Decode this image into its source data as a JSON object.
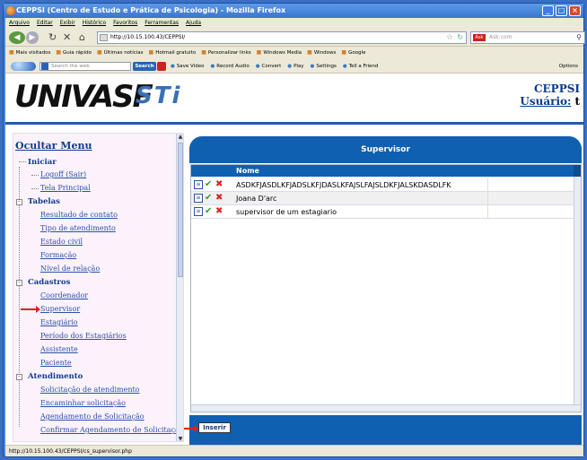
{
  "window": {
    "title": "CEPPSI (Centro de Estudo e Prática de Psicologia) - Mozilla Firefox"
  },
  "menu": [
    "Arquivo",
    "Editar",
    "Exibir",
    "Histórico",
    "Favoritos",
    "Ferramentas",
    "Ajuda"
  ],
  "nav": {
    "url": "http://10.15.100.43/CEPPSI/",
    "search_placeholder": "Ask.com"
  },
  "bookmarks": [
    "Mais visitados",
    "Guia rápido",
    "Últimas notícias",
    "Hotmail gratuito",
    "Personalizar links",
    "Windows Media",
    "Windows",
    "Google"
  ],
  "toolbar2": {
    "search_placeholder": "Search the web",
    "search_btn": "Search",
    "items": [
      "Save Video",
      "Record Audio",
      "Convert",
      "Play",
      "Settings",
      "Tell a Friend"
    ],
    "options": "Options"
  },
  "header": {
    "logo1": "UNIVASF",
    "logo2": "STi",
    "org": "CEPPSI",
    "user_label": "Usuário:",
    "user_value": "t"
  },
  "sidebar": {
    "title": "Ocultar Menu",
    "groups": [
      {
        "label": "Iniciar",
        "items": [
          "Logoff (Sair)",
          "Tela Principal"
        ]
      },
      {
        "label": "Tabelas",
        "items": [
          "Resultado de contato",
          "Tipo de atendimento",
          "Estado civil",
          "Formação",
          "Nível de relação"
        ]
      },
      {
        "label": "Cadastros",
        "items": [
          "Coordenador",
          "Supervisor",
          "Estagiário",
          "Período dos Estagiários",
          "Assistente",
          "Paciente"
        ]
      },
      {
        "label": "Atendimento",
        "items": [
          "Solicitação de atendimento",
          "Encaminhar solicitação",
          "Agendamento de Solicitação",
          "Confirmar Agendamento de Solicitação"
        ]
      }
    ]
  },
  "main": {
    "title": "Supervisor",
    "column": "Nome",
    "rows": [
      "ASDKFJASDLKFJADSLKFJDASLKFAJSLFAJSLDKFJALSKDASDLFK",
      "Joana D'arc",
      "supervisor de um estagiario"
    ],
    "insert_btn": "Inserir"
  },
  "status": {
    "text": "http://10.15.100.43/CEPPSI/cs_supervisor.php"
  }
}
